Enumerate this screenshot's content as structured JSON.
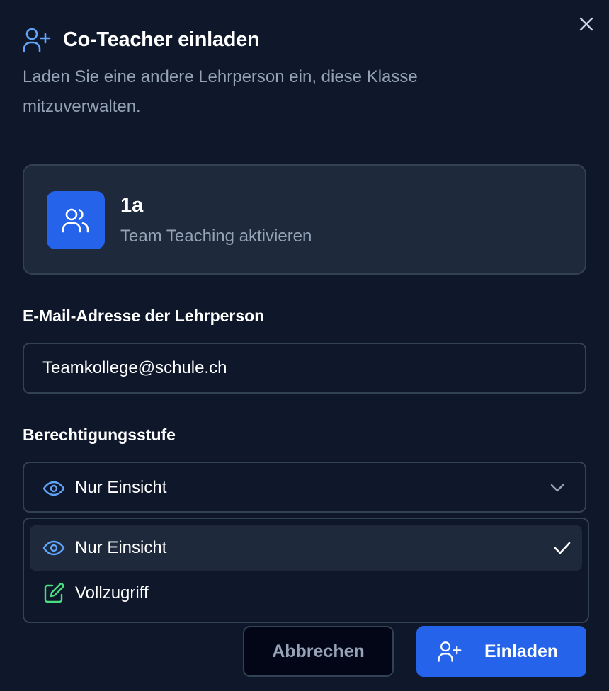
{
  "dialog": {
    "title": "Co-Teacher einladen",
    "subtitle": "Laden Sie eine andere Lehrperson ein, diese Klasse mitzuverwalten.",
    "header_icon": "user-plus-icon",
    "close_icon": "close-icon"
  },
  "class_card": {
    "icon": "users-icon",
    "name": "1a",
    "subtitle": "Team Teaching aktivieren"
  },
  "email": {
    "label": "E-Mail-Adresse der Lehrperson",
    "value": "Teamkollege@schule.ch"
  },
  "permission": {
    "label": "Berechtigungsstufe",
    "selected": "Nur Einsicht",
    "selected_icon": "eye-icon",
    "options": [
      {
        "label": "Nur Einsicht",
        "icon": "eye-icon",
        "selected": true
      },
      {
        "label": "Vollzugriff",
        "icon": "edit-icon",
        "selected": false
      }
    ]
  },
  "actions": {
    "cancel_label": "Abbrechen",
    "invite_label": "Einladen",
    "invite_icon": "user-plus-icon"
  },
  "colors": {
    "background": "#0f172a",
    "card": "#1e293b",
    "border": "#334155",
    "accent": "#2563eb",
    "eye_icon": "#60a5fa",
    "edit_icon": "#4ade80",
    "muted_text": "#94a3b8"
  }
}
